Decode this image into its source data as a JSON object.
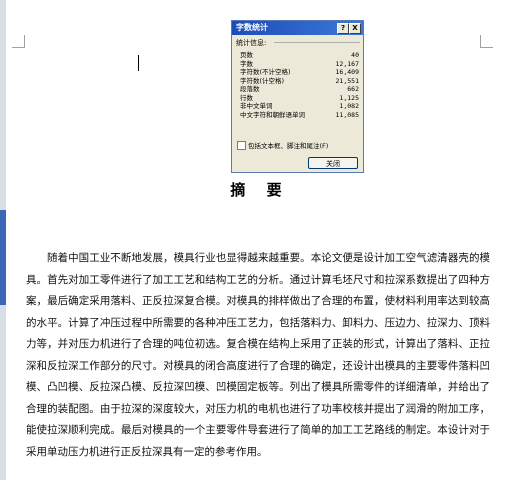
{
  "dialog": {
    "title": "字数统计",
    "help_label": "?",
    "close_x_label": "X",
    "group_label": "统计信息:",
    "stats": [
      {
        "label": "页数",
        "value": "40"
      },
      {
        "label": "字数",
        "value": "12,167"
      },
      {
        "label": "字符数(不计空格)",
        "value": "16,409"
      },
      {
        "label": "字符数(计空格)",
        "value": "21,551"
      },
      {
        "label": "段落数",
        "value": "662"
      },
      {
        "label": "行数",
        "value": "1,125"
      },
      {
        "label": "非中文单词",
        "value": "1,082"
      },
      {
        "label": "中文字符和朝鲜语单词",
        "value": "11,085"
      }
    ],
    "checkbox_label": "包括文本框、脚注和尾注(F)",
    "checkbox_checked": false,
    "close_button_label": "关闭"
  },
  "document": {
    "heading": "摘 要",
    "paragraph": "随着中国工业不断地发展，模具行业也显得越来越重要。本论文便是设计加工空气滤清器壳的模具。首先对加工零件进行了加工工艺和结构工艺的分析。通过计算毛坯尺寸和拉深系数提出了四种方案，最后确定采用落料、正反拉深复合模。对模具的排样做出了合理的布置，使材料利用率达到较高的水平。计算了冲压过程中所需要的各种冲压工艺力，包括落料力、卸料力、压边力、拉深力、顶料力等，并对压力机进行了合理的吨位初选。复合模在结构上采用了正装的形式，计算出了落料、正拉深和反拉深工作部分的尺寸。对模具的闭合高度进行了合理的确定，还设计出模具的主要零件落料凹模、凸凹模、反拉深凸模、反拉深凹模、凹模固定板等。列出了模具所需零件的详细清单，并给出了合理的装配图。由于拉深的深度较大，对压力机的电机也进行了功率校核并提出了润滑的附加工序，能使拉深顺利完成。最后对模具的一个主要零件导套进行了简单的加工工艺路线的制定。本设计对于采用单动压力机进行正反拉深具有一定的参考作用。"
  }
}
